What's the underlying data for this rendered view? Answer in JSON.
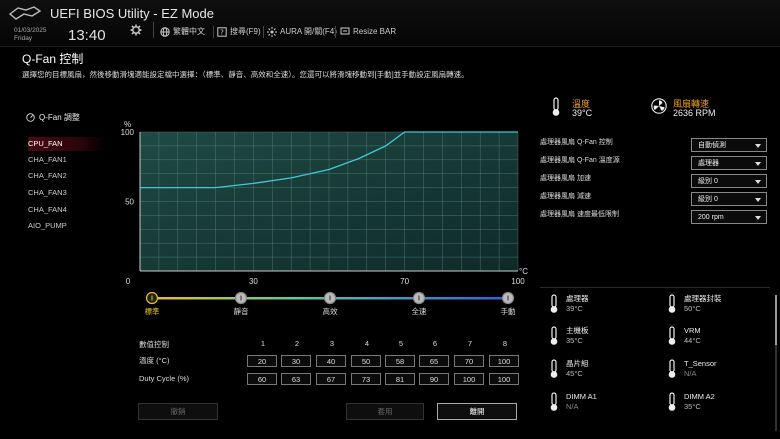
{
  "header": {
    "app_title": "UEFI BIOS Utility - EZ Mode",
    "date": "01/03/2025",
    "day": "Friday",
    "time": "13:40",
    "toolbar": [
      {
        "icon": "globe-icon",
        "label": "繁體中文"
      },
      {
        "icon": "search-icon",
        "label": "搜尋(F9)"
      },
      {
        "icon": "aura-icon",
        "label": "AURA 開/關(F4)"
      },
      {
        "icon": "resize-bar-icon",
        "label": "Resize BAR"
      }
    ]
  },
  "page": {
    "title": "Q-Fan 控制",
    "description": "選擇您的目標風扇，然後移動滑塊適能設定檔中選擇：（標準、靜音、高效和全速）。您還可以將滑塊移動到[手動]並手動設定風扇轉速。"
  },
  "fan_list": {
    "heading": "Q-Fan 調整",
    "items": [
      "CPU_FAN",
      "CHA_FAN1",
      "CHA_FAN2",
      "CHA_FAN3",
      "CHA_FAN4",
      "AIO_PUMP"
    ],
    "selected": "CPU_FAN"
  },
  "chart_data": {
    "type": "line",
    "ylabel": "%",
    "xlabel": "°C",
    "xlim": [
      0,
      100
    ],
    "ylim": [
      0,
      100
    ],
    "x_ticks": [
      "0",
      "30",
      "70",
      "100"
    ],
    "y_ticks": [
      "0",
      "50",
      "100"
    ],
    "grid": true,
    "x": [
      0,
      20,
      30,
      40,
      50,
      58,
      65,
      70,
      100
    ],
    "y": [
      60,
      60,
      63,
      67,
      73,
      81,
      90,
      100,
      100
    ],
    "accent": "#40c8d8"
  },
  "profiles": {
    "items": [
      "標準",
      "靜音",
      "高效",
      "全速",
      "手動"
    ],
    "selected": "標準"
  },
  "table": {
    "header_label": "數值控制",
    "columns": [
      "1",
      "2",
      "3",
      "4",
      "5",
      "6",
      "7",
      "8"
    ],
    "temp_label": "溫度 (°C)",
    "temps": [
      "20",
      "30",
      "40",
      "50",
      "58",
      "65",
      "70",
      "100"
    ],
    "duty_label": "Duty Cycle (%)",
    "duty": [
      "60",
      "63",
      "67",
      "73",
      "81",
      "90",
      "100",
      "100"
    ]
  },
  "buttons": {
    "undo": "撤銷",
    "apply": "套用",
    "exit": "離開"
  },
  "readouts": {
    "temp_label": "溫度",
    "temp_value": "39°C",
    "speed_label": "風扇轉速",
    "speed_value": "2636 RPM"
  },
  "settings": [
    {
      "label": "處理器風扇 Q-Fan 控制",
      "value": "自動偵測"
    },
    {
      "label": "處理器風扇 Q-Fan 溫度源",
      "value": "處理器"
    },
    {
      "label": "處理器風扇 加速",
      "value": "級別 0"
    },
    {
      "label": "處理器風扇 減速",
      "value": "級別 0"
    },
    {
      "label": "處理器風扇 速度最低限制",
      "value": "200 rpm"
    }
  ],
  "sensors": [
    {
      "name": "處理器",
      "value": "39°C"
    },
    {
      "name": "處理器封裝",
      "value": "50°C"
    },
    {
      "name": "主機板",
      "value": "35°C"
    },
    {
      "name": "VRM",
      "value": "44°C"
    },
    {
      "name": "晶片組",
      "value": "45°C"
    },
    {
      "name": "T_Sensor",
      "value": "N/A"
    },
    {
      "name": "DIMM A1",
      "value": "N/A"
    },
    {
      "name": "DIMM A2",
      "value": "35°C"
    }
  ],
  "colors": {
    "accent": "#f0a020",
    "curve": "#40c8d8",
    "brand": "#8a1020"
  }
}
